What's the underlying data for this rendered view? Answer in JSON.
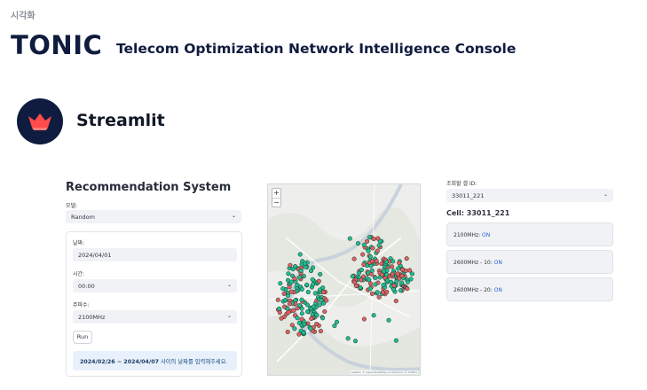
{
  "header": {
    "breadcrumb": "시각화",
    "brand": "TONIC",
    "brand_subtitle": "Telecom Optimization Network Intelligence Console",
    "logo_text": "Streamlit"
  },
  "recommendation": {
    "title": "Recommendation System",
    "model_label": "모델:",
    "model_value": "Random",
    "date_label": "날짜:",
    "date_value": "2024/04/01",
    "time_label": "시간:",
    "time_value": "00:00",
    "freq_label": "주파수:",
    "freq_value": "2100MHz",
    "run_label": "Run",
    "info_range": "2024/02/26 ~ 2024/04/07",
    "info_text": " 사이의 날짜를 입력해주세요."
  },
  "map": {
    "zoom_in": "+",
    "zoom_out": "−",
    "attribution": "Leaflet | © OpenStreetMap contributors © CARTO",
    "colors": {
      "on": "#1fbf8f",
      "off": "#e0615f"
    }
  },
  "cell_panel": {
    "select_label": "조회할 셀 ID:",
    "select_value": "33011_221",
    "cell_title": "Cell: 33011_221",
    "statuses": [
      {
        "band": "2100MHz: ",
        "state": "ON"
      },
      {
        "band": "2600MHz - 10: ",
        "state": "ON"
      },
      {
        "band": "2600MHz - 20: ",
        "state": "ON"
      }
    ]
  }
}
